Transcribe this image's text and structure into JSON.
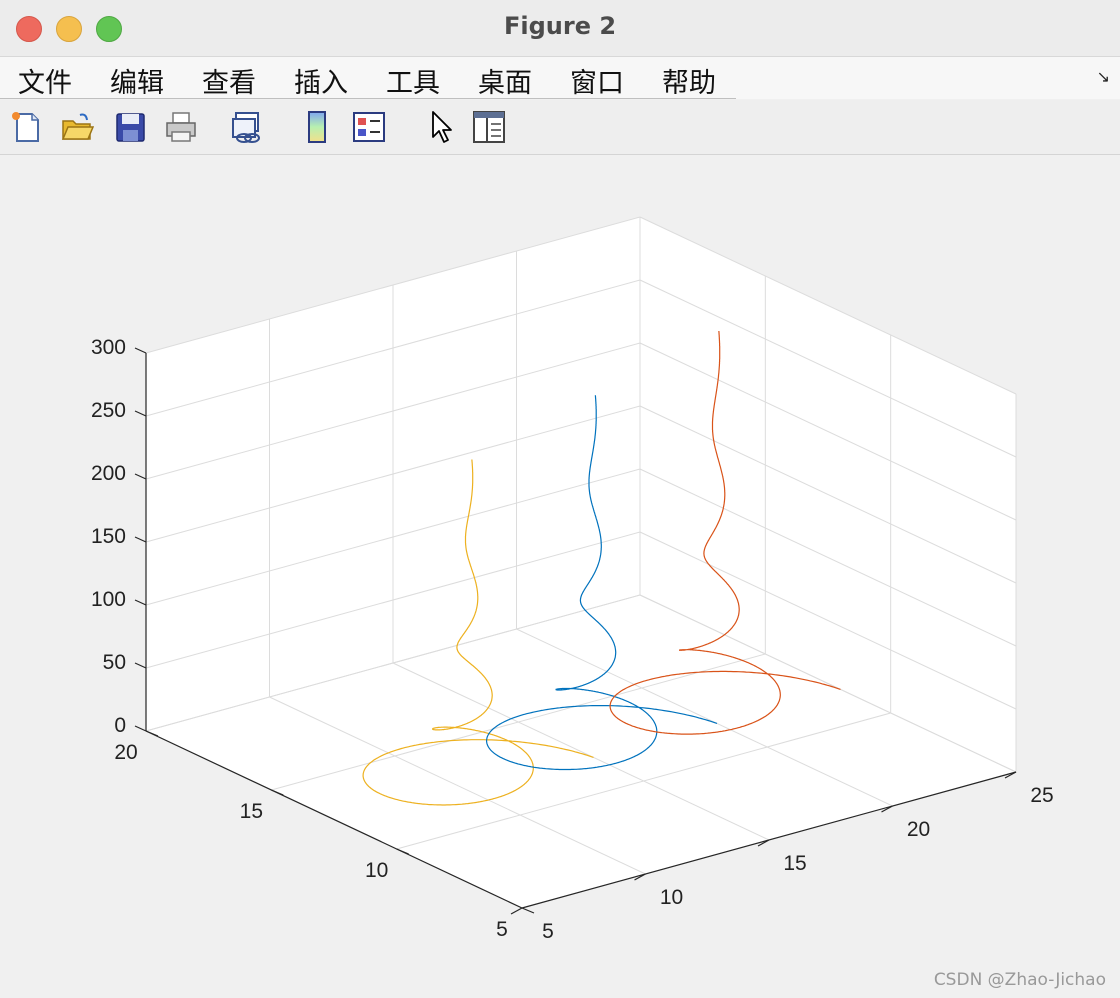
{
  "window": {
    "title": "Figure 2"
  },
  "menu": {
    "items": [
      "文件",
      "编辑",
      "查看",
      "插入",
      "工具",
      "桌面",
      "窗口",
      "帮助"
    ],
    "overflow_arrow": "↘"
  },
  "toolbar": {
    "buttons": [
      "new-figure-icon",
      "open-file-icon",
      "save-icon",
      "print-icon",
      "link-plot-icon",
      "colorbar-icon",
      "legend-icon",
      "pointer-icon",
      "property-inspector-icon"
    ]
  },
  "chart_data": {
    "type": "line3d",
    "x_ticks": [
      "5",
      "10",
      "15",
      "20",
      "25"
    ],
    "y_ticks": [
      "5",
      "10",
      "15",
      "20"
    ],
    "z_ticks": [
      "0",
      "50",
      "100",
      "150",
      "200",
      "250",
      "300"
    ],
    "xlim": [
      5,
      25
    ],
    "ylim": [
      5,
      20
    ],
    "zlim": [
      0,
      300
    ],
    "grid": true,
    "colors": [
      "#edb120",
      "#0072bd",
      "#d95319"
    ],
    "series": [
      {
        "color": "#edb120",
        "center": [
          10,
          12
        ],
        "radius": 4,
        "z_top": 263
      },
      {
        "color": "#0072bd",
        "center": [
          15,
          12
        ],
        "radius": 4,
        "z_top": 287
      },
      {
        "color": "#d95319",
        "center": [
          20,
          12
        ],
        "radius": 4,
        "z_top": 311
      }
    ]
  },
  "watermark": "CSDN @Zhao-Jichao"
}
